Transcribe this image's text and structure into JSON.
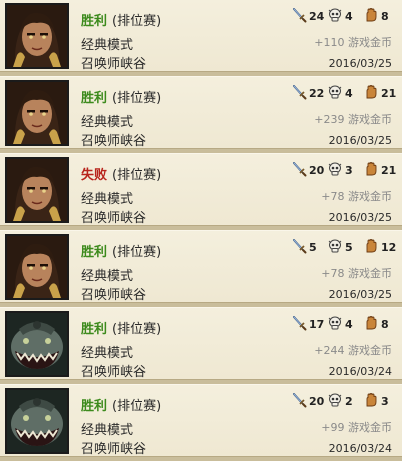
{
  "matches": [
    {
      "champion": "champion-female-portrait",
      "result": "胜利",
      "is_win": true,
      "queue": "(排位赛)",
      "mode": "经典模式",
      "map": "召唤师峡谷",
      "kills": "24",
      "deaths": "4",
      "assists": "8",
      "gold": "+110 游戏金币",
      "date": "2016/03/25"
    },
    {
      "champion": "champion-female-portrait",
      "result": "胜利",
      "is_win": true,
      "queue": "(排位赛)",
      "mode": "经典模式",
      "map": "召唤师峡谷",
      "kills": "22",
      "deaths": "4",
      "assists": "21",
      "gold": "+239 游戏金币",
      "date": "2016/03/25"
    },
    {
      "champion": "champion-female-portrait",
      "result": "失败",
      "is_win": false,
      "queue": "(排位赛)",
      "mode": "经典模式",
      "map": "召唤师峡谷",
      "kills": "20",
      "deaths": "3",
      "assists": "21",
      "gold": "+78 游戏金币",
      "date": "2016/03/25"
    },
    {
      "champion": "champion-female-portrait",
      "result": "胜利",
      "is_win": true,
      "queue": "(排位赛)",
      "mode": "经典模式",
      "map": "召唤师峡谷",
      "kills": "5",
      "deaths": "5",
      "assists": "12",
      "gold": "+78 游戏金币",
      "date": "2016/03/25"
    },
    {
      "champion": "champion-fish-monster-portrait",
      "result": "胜利",
      "is_win": true,
      "queue": "(排位赛)",
      "mode": "经典模式",
      "map": "召唤师峡谷",
      "kills": "17",
      "deaths": "4",
      "assists": "8",
      "gold": "+244 游戏金币",
      "date": "2016/03/24"
    },
    {
      "champion": "champion-fish-monster-portrait",
      "result": "胜利",
      "is_win": true,
      "queue": "(排位赛)",
      "mode": "经典模式",
      "map": "召唤师峡谷",
      "kills": "20",
      "deaths": "2",
      "assists": "3",
      "gold": "+99 游戏金币",
      "date": "2016/03/24"
    }
  ],
  "icons": {
    "kills": "sword-icon",
    "deaths": "skull-icon",
    "assists": "hand-icon"
  },
  "colors": {
    "win": "#3c8a1c",
    "loss": "#b8241c"
  }
}
